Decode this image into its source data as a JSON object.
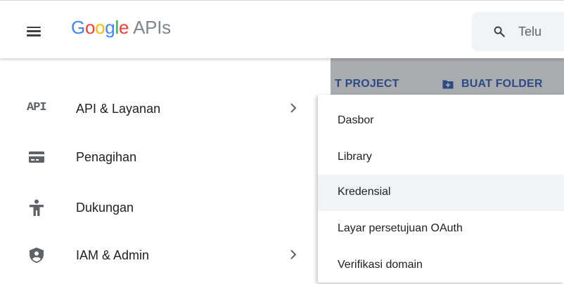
{
  "header": {
    "logo": [
      "G",
      "o",
      "o",
      "g",
      "l",
      "e"
    ],
    "logo_suffix": "APIs",
    "search_placeholder": "Telu"
  },
  "action_bar": {
    "project_label": "T PROJECT",
    "folder_label": "BUAT FOLDER"
  },
  "sidebar": {
    "items": [
      {
        "label": "API & Layanan",
        "icon": "api-icon"
      },
      {
        "label": "Penagihan",
        "icon": "billing-card-icon"
      },
      {
        "label": "Dukungan",
        "icon": "support-person-icon"
      },
      {
        "label": "IAM & Admin",
        "icon": "shield-icon"
      }
    ],
    "api_glyph": "API"
  },
  "submenu": {
    "items": [
      {
        "label": "Dasbor"
      },
      {
        "label": "Library"
      },
      {
        "label": "Kredensial"
      },
      {
        "label": "Layar persetujuan OAuth"
      },
      {
        "label": "Verifikasi domain"
      }
    ]
  },
  "colors": {
    "google_blue": "#4285f4",
    "google_red": "#ea4335",
    "google_yellow": "#fbbc05",
    "google_green": "#34a853",
    "action_text": "#2b4a86",
    "active_item_bg": "#f1f3f4"
  }
}
